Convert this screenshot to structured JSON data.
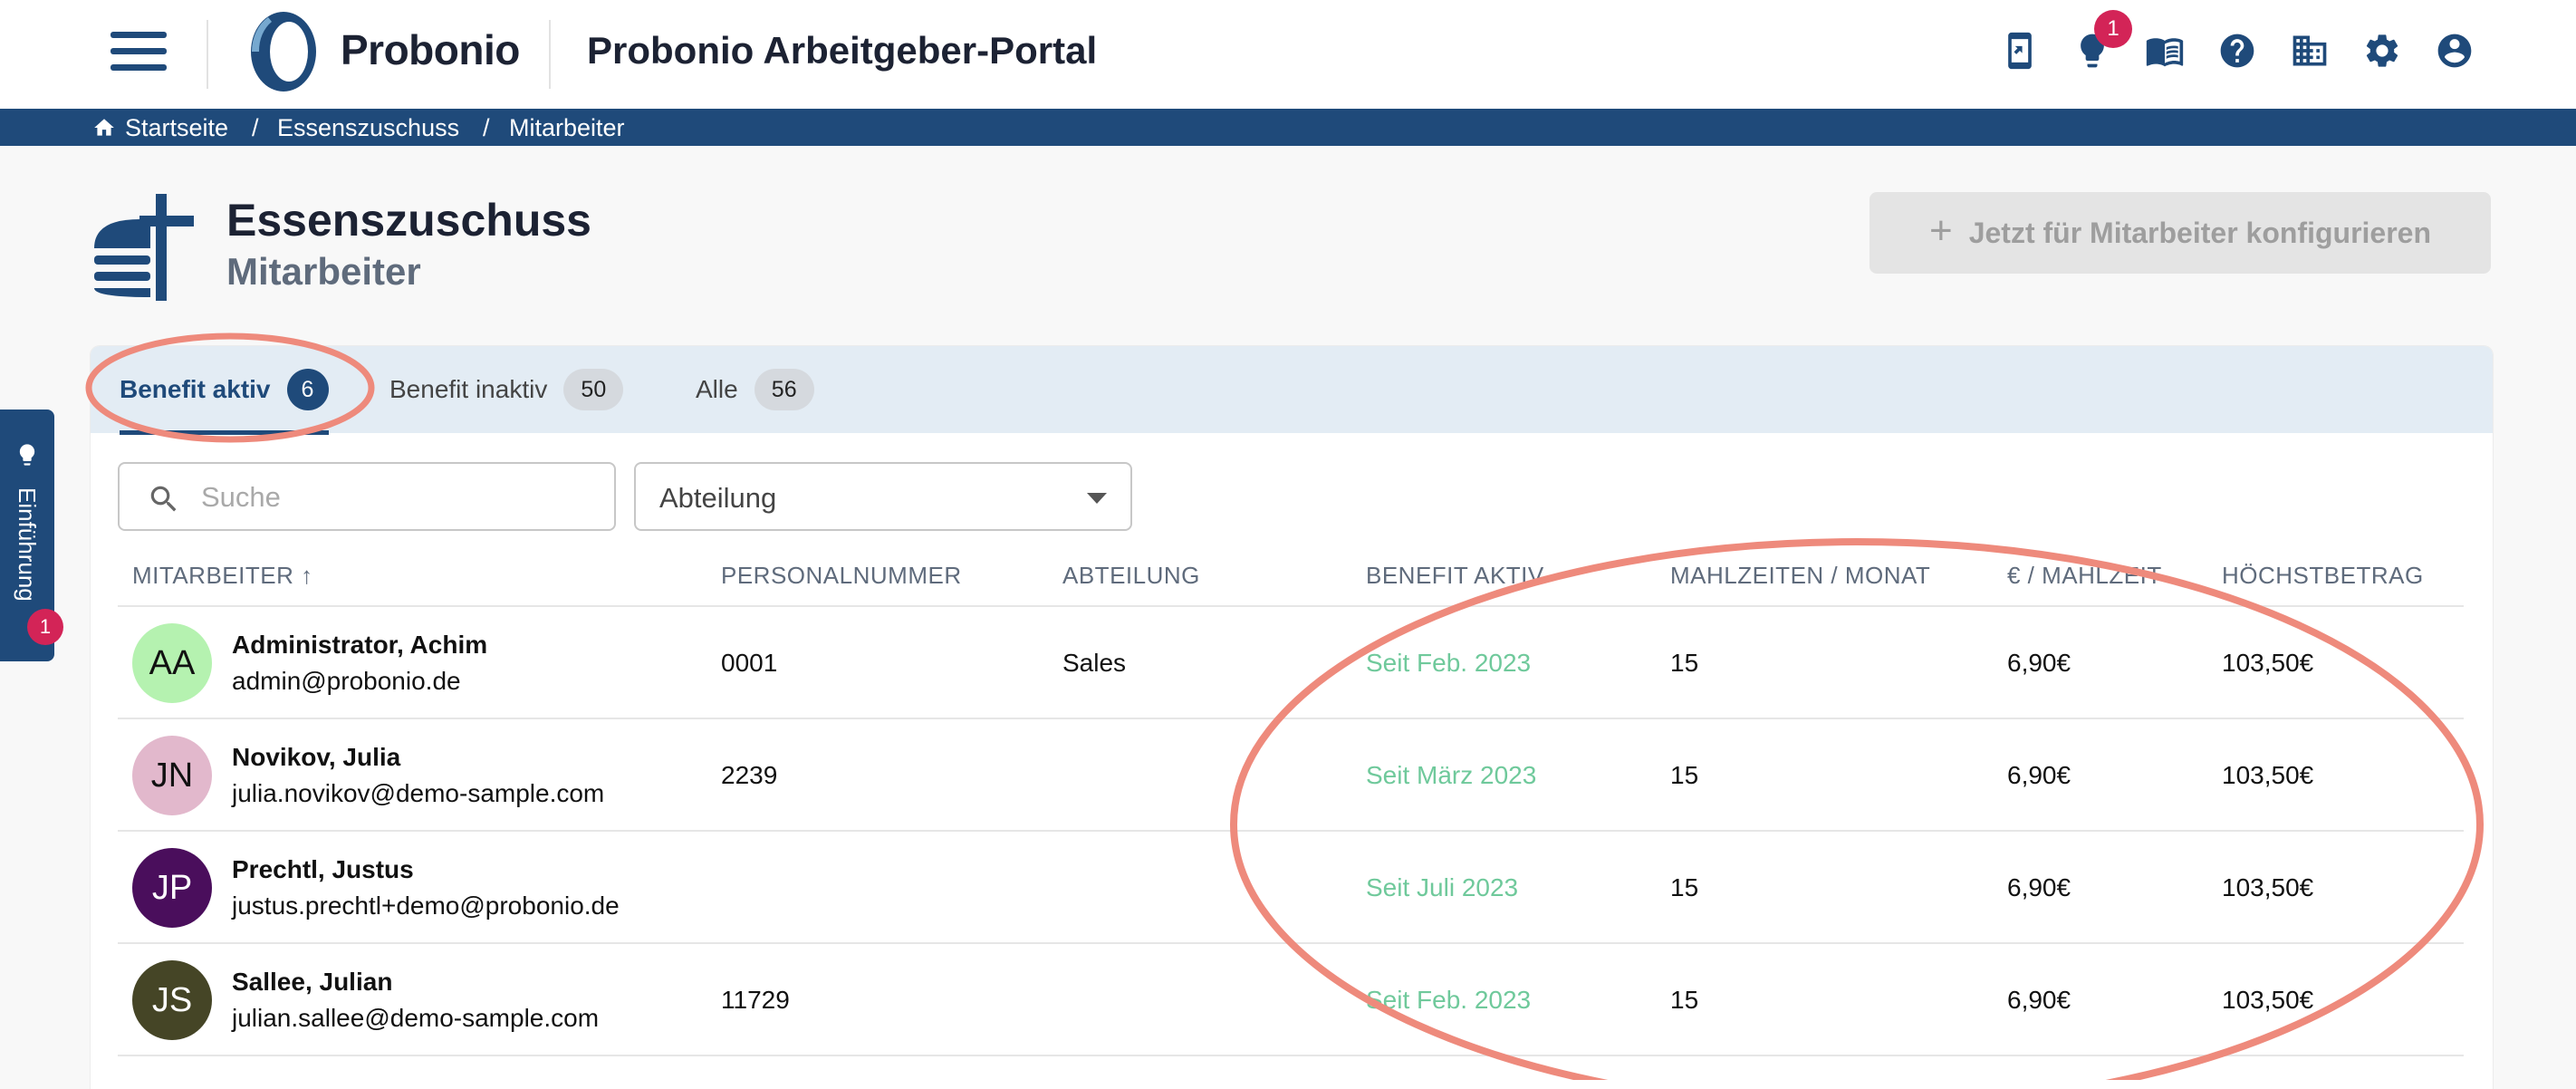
{
  "header": {
    "brand": "Probonio",
    "portal_title": "Probonio Arbeitgeber-Portal",
    "notification_count": "1",
    "icons": [
      "app-download-icon",
      "lightbulb-icon",
      "book-icon",
      "help-icon",
      "company-icon",
      "settings-icon",
      "account-icon"
    ]
  },
  "breadcrumb": {
    "items": [
      "Startseite",
      "Essenszuschuss",
      "Mitarbeiter"
    ],
    "separator": "/"
  },
  "page": {
    "title": "Essenszuschuss",
    "subtitle": "Mitarbeiter",
    "configure_button": "Jetzt für Mitarbeiter konfigurieren",
    "configure_icon": "+"
  },
  "tabs": [
    {
      "label": "Benefit aktiv",
      "count": "6"
    },
    {
      "label": "Benefit inaktiv",
      "count": "50"
    },
    {
      "label": "Alle",
      "count": "56"
    }
  ],
  "filters": {
    "search_placeholder": "Suche",
    "department_label": "Abteilung"
  },
  "table": {
    "columns": [
      "MITARBEITER",
      "PERSONALNUMMER",
      "ABTEILUNG",
      "BENEFIT AKTIV",
      "MAHLZEITEN / MONAT",
      "€ / MAHLZEIT",
      "HÖCHSTBETRAG"
    ],
    "sort_indicator": "↑",
    "rows": [
      {
        "initials": "AA",
        "name": "Administrator, Achim",
        "email": "admin@probonio.de",
        "personalnummer": "0001",
        "abteilung": "Sales",
        "benefit_aktiv": "Seit Feb. 2023",
        "mahlzeiten": "15",
        "euro_mahlzeit": "6,90€",
        "hoechstbetrag": "103,50€",
        "avatar_color": "#b5f2b0"
      },
      {
        "initials": "JN",
        "name": "Novikov, Julia",
        "email": "julia.novikov@demo-sample.com",
        "personalnummer": "2239",
        "abteilung": "",
        "benefit_aktiv": "Seit März 2023",
        "mahlzeiten": "15",
        "euro_mahlzeit": "6,90€",
        "hoechstbetrag": "103,50€",
        "avatar_color": "#e2b8cc"
      },
      {
        "initials": "JP",
        "name": "Prechtl, Justus",
        "email": "justus.prechtl+demo@probonio.de",
        "personalnummer": "",
        "abteilung": "",
        "benefit_aktiv": "Seit Juli 2023",
        "mahlzeiten": "15",
        "euro_mahlzeit": "6,90€",
        "hoechstbetrag": "103,50€",
        "avatar_color": "#4a0e5c"
      },
      {
        "initials": "JS",
        "name": "Sallee, Julian",
        "email": "julian.sallee@demo-sample.com",
        "personalnummer": "11729",
        "abteilung": "",
        "benefit_aktiv": "Seit Feb. 2023",
        "mahlzeiten": "15",
        "euro_mahlzeit": "6,90€",
        "hoechstbetrag": "103,50€",
        "avatar_color": "#454526"
      }
    ]
  },
  "intro_tab": {
    "label": "Einführung",
    "badge": "1"
  },
  "colors": {
    "brand_blue": "#1f4a7a",
    "badge_red": "#d32457",
    "benefit_green": "#6fc99b",
    "annotation": "#ee8a7c"
  }
}
